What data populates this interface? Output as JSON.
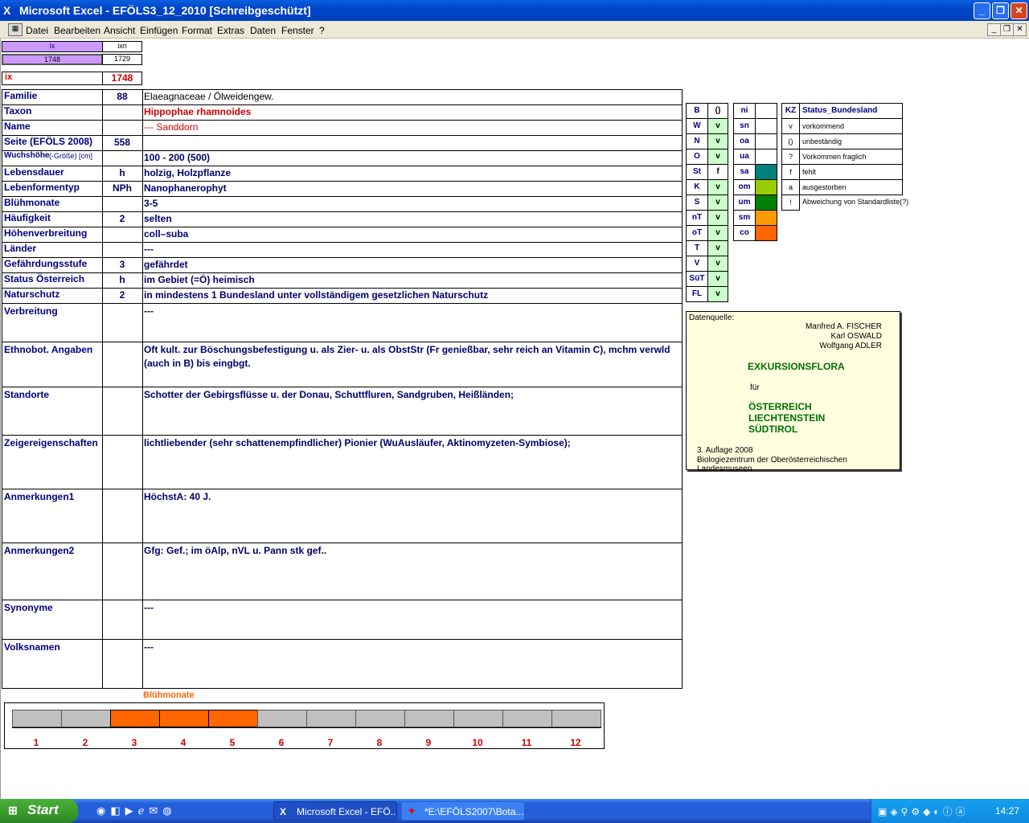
{
  "window": {
    "title": "Microsoft Excel - EFÖLS3_12_2010  [Schreibgeschützt]"
  },
  "menu": [
    "Datei",
    "Bearbeiten",
    "Ansicht",
    "Einfügen",
    "Format",
    "Extras",
    "Daten",
    "Fenster",
    "?"
  ],
  "topcells": {
    "h1": "ix",
    "h2": "ixn",
    "v1": "1748",
    "v2": "1729",
    "ix_label": "ix",
    "ix_value": "1748"
  },
  "rows": [
    {
      "label": "Familie",
      "code": "88",
      "value": "Elaeagnaceae  /  Ölweidengew."
    },
    {
      "label": "Taxon",
      "code": "",
      "value": "Hippophae rhamnoides"
    },
    {
      "label": "Name",
      "code": "",
      "value": "--- Sanddorn"
    },
    {
      "label": "Seite (EFÖLS 2008)",
      "code": "558",
      "value": ""
    },
    {
      "label": "Wuchshöhe",
      "label_small": "(-Größe) [cm]",
      "code": "",
      "value": " 100 - 200 (500)"
    },
    {
      "label": "Lebensdauer",
      "code": "h",
      "value": "holzig, Holzpflanze"
    },
    {
      "label": "Lebenformentyp",
      "code": "NPh",
      "value": "Nanophanerophyt"
    },
    {
      "label": "Blühmonate",
      "code": "",
      "value": " 3-5"
    },
    {
      "label": "Häufigkeit",
      "code": "2",
      "value": "selten"
    },
    {
      "label": "Höhenverbreitung",
      "code": "",
      "value": "coll–suba"
    },
    {
      "label": "Länder",
      "code": "",
      "value": " ---"
    },
    {
      "label": "Gefährdungsstufe",
      "code": "3",
      "value": "gefährdet"
    },
    {
      "label": "Status Österreich",
      "code": "h",
      "value": "im Gebiet (=Ö) heimisch"
    },
    {
      "label": "Naturschutz",
      "code": "2",
      "value": "in mindestens 1 Bundesland unter vollständigem gesetzlichen Naturschutz"
    }
  ],
  "bigrows": [
    {
      "label": "Verbreitung",
      "value": " ---",
      "value2": ""
    },
    {
      "label": "Ethnobot. Angaben",
      "value": "Oft kult. zur Böschungsbefestigung u. als Zier- u. als ObstStr (Fr genießbar, sehr reich an Vitamin C), mchm verwld",
      "value2": "(auch in B) bis eingbgt."
    },
    {
      "label": "Standorte",
      "value": "Schotter der Gebirgsflüsse u. der Donau, Schuttfluren, Sandgruben, Heißländen;",
      "value2": ""
    },
    {
      "label": "Zeigereigenschaften",
      "value": "lichtliebender (sehr schattenempfindlicher) Pionier (WuAusläufer, Aktinomyzeten-Symbiose);",
      "value2": ""
    },
    {
      "label": "Anmerkungen1",
      "value": "HöchstA: 40 J.",
      "value2": ""
    },
    {
      "label": "Anmerkungen2",
      "value": "Gfg: Gef.; im öAlp, nVL u. Pann stk gef..",
      "value2": ""
    },
    {
      "label": "Synonyme",
      "value": "---",
      "value2": ""
    },
    {
      "label": "Volksnamen",
      "value": "---",
      "value2": ""
    }
  ],
  "regions": [
    {
      "code": "B",
      "val": "()"
    },
    {
      "code": "W",
      "val": "v"
    },
    {
      "code": "N",
      "val": "v"
    },
    {
      "code": "O",
      "val": "v"
    },
    {
      "code": "St",
      "val": "f"
    },
    {
      "code": "K",
      "val": "v"
    },
    {
      "code": "S",
      "val": "v"
    },
    {
      "code": "nT",
      "val": "v"
    },
    {
      "code": "oT",
      "val": "v"
    },
    {
      "code": "T",
      "val": "v"
    },
    {
      "code": "V",
      "val": "v"
    },
    {
      "code": "SüT",
      "val": "v"
    },
    {
      "code": "FL",
      "val": "v"
    }
  ],
  "altitudes": [
    {
      "code": "ni",
      "color": "#ffffff"
    },
    {
      "code": "sn",
      "color": "#ffffff"
    },
    {
      "code": "oa",
      "color": "#ffffff"
    },
    {
      "code": "ua",
      "color": "#ffffff"
    },
    {
      "code": "sa",
      "color": "#007f7f"
    },
    {
      "code": "om",
      "color": "#99cc00"
    },
    {
      "code": "um",
      "color": "#008000"
    },
    {
      "code": "sm",
      "color": "#ff9900"
    },
    {
      "code": "co",
      "color": "#ff6600"
    }
  ],
  "status_legend": {
    "header_kz": "KZ",
    "header_label": "Status_Bundesland",
    "items": [
      {
        "kz": "v",
        "text": "vorkommend"
      },
      {
        "kz": "()",
        "text": "unbeständig"
      },
      {
        "kz": "?",
        "text": "Vorkommen fraglich"
      },
      {
        "kz": "f",
        "text": "fehlt"
      },
      {
        "kz": "a",
        "text": "ausgestorben"
      },
      {
        "kz": "!",
        "text": "Abweichung von Standardliste(?)"
      }
    ]
  },
  "source": {
    "label": "Datenquelle:",
    "authors": [
      "Manfred A. FISCHER",
      "Karl OSWALD",
      "Wolfgang ADLER"
    ],
    "title": "EXKURSIONSFLORA",
    "fuer": "für",
    "countries": [
      "ÖSTERREICH",
      "LIECHTENSTEIN",
      "SÜDTIROL"
    ],
    "edition": "3. Auflage 2008",
    "publisher": "Biologiezentrum der Oberösterreichischen Landesmuseen"
  },
  "chart_data": {
    "type": "bar",
    "title": "Blühmonate",
    "categories": [
      "1",
      "2",
      "3",
      "4",
      "5",
      "6",
      "7",
      "8",
      "9",
      "10",
      "11",
      "12"
    ],
    "values": [
      0,
      0,
      1,
      1,
      1,
      0,
      0,
      0,
      0,
      0,
      0,
      0
    ],
    "colors": {
      "on": "#ff6600",
      "off": "#c0c0c0"
    }
  },
  "taskbar": {
    "start": "Start",
    "tasks": [
      "Microsoft Excel - EFÖ...",
      "*E:\\EFÖLS2007\\Bota..."
    ],
    "clock": "14:27"
  }
}
